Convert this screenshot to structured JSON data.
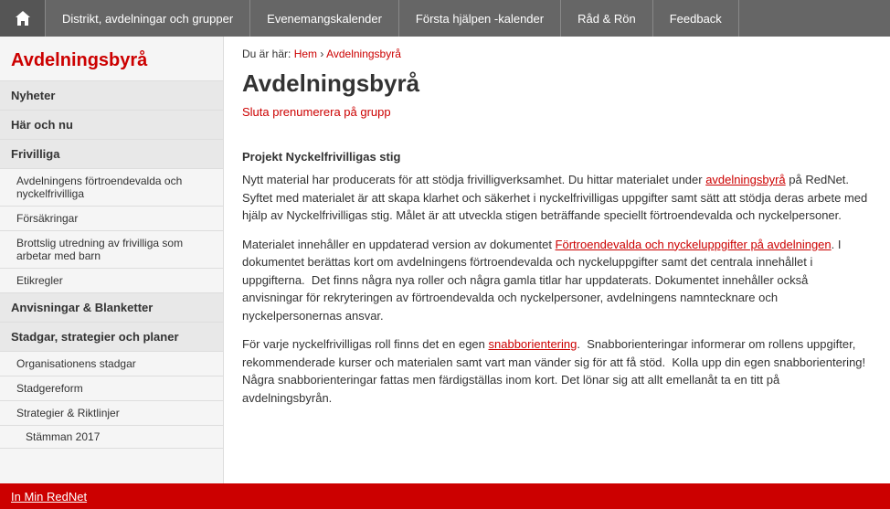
{
  "nav": {
    "home_icon": "🏠",
    "items": [
      {
        "label": "Distrikt, avdelningar och grupper"
      },
      {
        "label": "Evenemangskalender"
      },
      {
        "label": "Första hjälpen -kalender"
      },
      {
        "label": "Råd & Rön"
      },
      {
        "label": "Feedback"
      }
    ]
  },
  "sidebar": {
    "title": "Avdelningsbyrå",
    "sections": [
      {
        "header": "Nyheter",
        "items": []
      },
      {
        "header": "Här och nu",
        "items": []
      },
      {
        "header": "Frivilliga",
        "items": [
          {
            "label": "Avdelningens förtroendevalda och nyckelfrivilliga",
            "indent": 1
          },
          {
            "label": "Försäkringar",
            "indent": 1
          },
          {
            "label": "Brottslig utredning av frivilliga som arbetar med barn",
            "indent": 1
          },
          {
            "label": "Etikregler",
            "indent": 1
          }
        ]
      },
      {
        "header": "Anvisningar & Blanketter",
        "items": []
      },
      {
        "header": "Stadgar, strategier och planer",
        "items": [
          {
            "label": "Organisationens stadgar",
            "indent": 1
          },
          {
            "label": "Stadgereform",
            "indent": 1
          },
          {
            "label": "Strategier & Riktlinjer",
            "indent": 1
          },
          {
            "label": "Stämman 2017",
            "indent": 2
          }
        ]
      }
    ]
  },
  "breadcrumb": {
    "prefix": "Du är här:",
    "home": "Hem",
    "separator": "›",
    "current": "Avdelningsbyrå"
  },
  "main": {
    "title": "Avdelningsbyrå",
    "subscribe_link": "Sluta prenumerera på grupp",
    "section1": {
      "heading": "Projekt Nyckelfrivilligas stig",
      "paragraphs": [
        "Nytt material har producerats för att stödja frivilligverksamhet. Du hittar materialet under avdelningsbyrå på RedNet.  Syftet med materialet är att skapa klarhet och säkerhet i nyckelfrivilligas uppgifter samt sätt att stödja deras arbete med hjälp av Nyckelfrivilligas stig. Målet är att utveckla stigen beträffande speciellt förtroendevalda och nyckelpersoner.",
        "Materialet innehåller en uppdaterad version av dokumentet Förtroendevalda och nyckeluppgifter på avdelningen. I dokumentet berättas kort om avdelningens förtroendevalda och nyckeluppgifter samt det centrala innehållet i uppgifterna.  Det finns några nya roller och några gamla titlar har uppdaterats. Dokumentet innehåller också anvisningar för rekryteringen av förtroendevalda och nyckelpersoner, avdelningens namntecknare och nyckelpersonernas ansvar.",
        "För varje nyckelfrivilligas roll finns det en egen snabborientering.  Snabborienteringar informerar om rollens uppgifter, rekommenderade kurser och materialen samt vart man vänder sig för att få stöd.  Kolla upp din egen snabborientering! Några snabborienteringar fattas men färdigställas inom kort. Det lönar sig att allt emellanåt ta en titt på avdelningsbyrån."
      ],
      "link1_text": "avdelningsbyrå",
      "link2_text": "Förtroendevalda och nyckeluppgifter på avdelningen",
      "link3_text": "snabborientering"
    }
  },
  "bottom_bar": {
    "text": "In Min RedNet"
  }
}
